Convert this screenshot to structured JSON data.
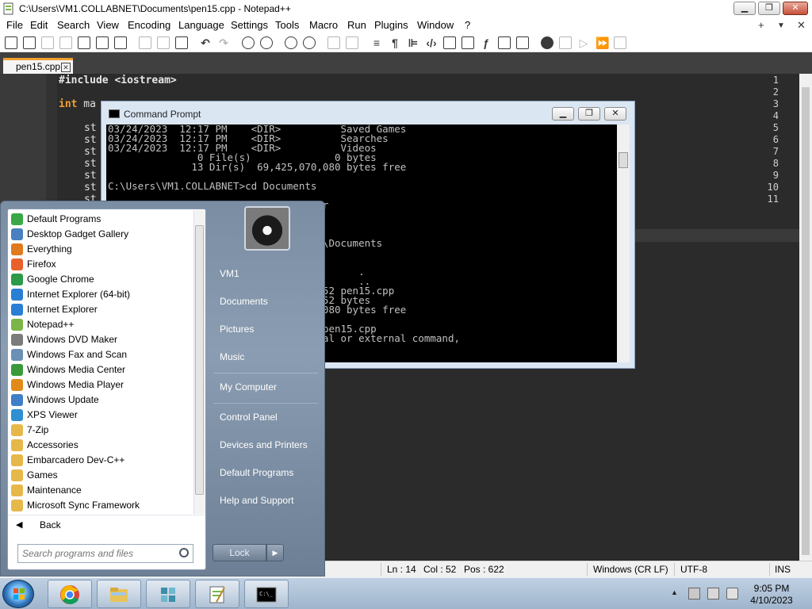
{
  "notepad": {
    "title": "C:\\Users\\VM1.COLLABNET\\Documents\\pen15.cpp - Notepad++",
    "window_controls": {
      "minimize": "▁",
      "maximize": "❐",
      "close": "✕"
    },
    "menu": [
      "File",
      "Edit",
      "Search",
      "View",
      "Encoding",
      "Language",
      "Settings",
      "Tools",
      "Macro",
      "Run",
      "Plugins",
      "Window",
      "?"
    ],
    "menu_right": {
      "plus": "+",
      "dropdown": "▼",
      "close": "✕"
    },
    "tab": {
      "label": "pen15.cpp",
      "close": "✕"
    },
    "line_numbers": [
      "1",
      "2",
      "3",
      "4",
      "5",
      "6",
      "7",
      "8",
      "9",
      "10",
      "11"
    ],
    "code": {
      "line1_directive": "#include",
      "line1_header": " <iostream>",
      "line3_kw": "int",
      "line3_rest": " ma",
      "line5": "st",
      "line6": "st",
      "line7": "st",
      "line8": "st",
      "line9": "st",
      "line10": "st",
      "line11": "st"
    },
    "status": {
      "ln": "Ln : 14",
      "col": "Col : 52",
      "pos": "Pos : 622",
      "eol": "Windows (CR LF)",
      "encoding": "UTF-8",
      "mode": "INS"
    }
  },
  "cmd": {
    "title": "Command Prompt",
    "controls": {
      "minimize": "▁",
      "maximize": "❐",
      "close": "✕"
    },
    "lines": [
      "03/24/2023  12:17 PM    <DIR>          Saved Games",
      "03/24/2023  12:17 PM    <DIR>          Searches",
      "03/24/2023  12:17 PM    <DIR>          Videos",
      "               0 File(s)              0 bytes",
      "              13 Dir(s)  69,425,070,080 bytes free",
      "",
      "C:\\Users\\VM1.COLLABNET>cd Documents",
      "",
      "                                   ir",
      "",
      "",
      "",
      "                                  ET\\Documents",
      "",
      "",
      "                                          .",
      "                                          ..",
      "                                   652 pen15.cpp",
      "                                   652 bytes",
      "                                  0,080 bytes free",
      "",
      "                                  + pen15.cpp",
      "                                  rnal or external command,"
    ]
  },
  "start_menu": {
    "programs": [
      {
        "label": "Default Programs",
        "color": "#3aa845"
      },
      {
        "label": "Desktop Gadget Gallery",
        "color": "#4a7fc0"
      },
      {
        "label": "Everything",
        "color": "#e07a1f"
      },
      {
        "label": "Firefox",
        "color": "#e8612c"
      },
      {
        "label": "Google Chrome",
        "color": "#2c9a48"
      },
      {
        "label": "Internet Explorer (64-bit)",
        "color": "#2a7fd4"
      },
      {
        "label": "Internet Explorer",
        "color": "#2a7fd4"
      },
      {
        "label": "Notepad++",
        "color": "#7ab648"
      },
      {
        "label": "Windows DVD Maker",
        "color": "#7b7b7b"
      },
      {
        "label": "Windows Fax and Scan",
        "color": "#6b8fb5"
      },
      {
        "label": "Windows Media Center",
        "color": "#3a9a3a"
      },
      {
        "label": "Windows Media Player",
        "color": "#e08a1a"
      },
      {
        "label": "Windows Update",
        "color": "#3f7fc7"
      },
      {
        "label": "XPS Viewer",
        "color": "#2f8fd0"
      },
      {
        "label": "7-Zip",
        "color": "#e6b84a"
      },
      {
        "label": "Accessories",
        "color": "#e6b84a"
      },
      {
        "label": "Embarcadero Dev-C++",
        "color": "#e6b84a"
      },
      {
        "label": "Games",
        "color": "#e6b84a"
      },
      {
        "label": "Maintenance",
        "color": "#e6b84a"
      },
      {
        "label": "Microsoft Sync Framework",
        "color": "#e6b84a"
      }
    ],
    "back_arrow": "◀",
    "back_label": "Back",
    "search_placeholder": "Search programs and files",
    "right_links": [
      "VM1",
      "Documents",
      "Pictures",
      "Music",
      "My Computer",
      "Control Panel",
      "Devices and Printers",
      "Default Programs",
      "Help and Support"
    ],
    "lock_label": "Lock",
    "lock_arrow": "▶"
  },
  "taskbar": {
    "time": "9:05 PM",
    "date": "4/10/2023",
    "tray_arrow": "▲"
  }
}
